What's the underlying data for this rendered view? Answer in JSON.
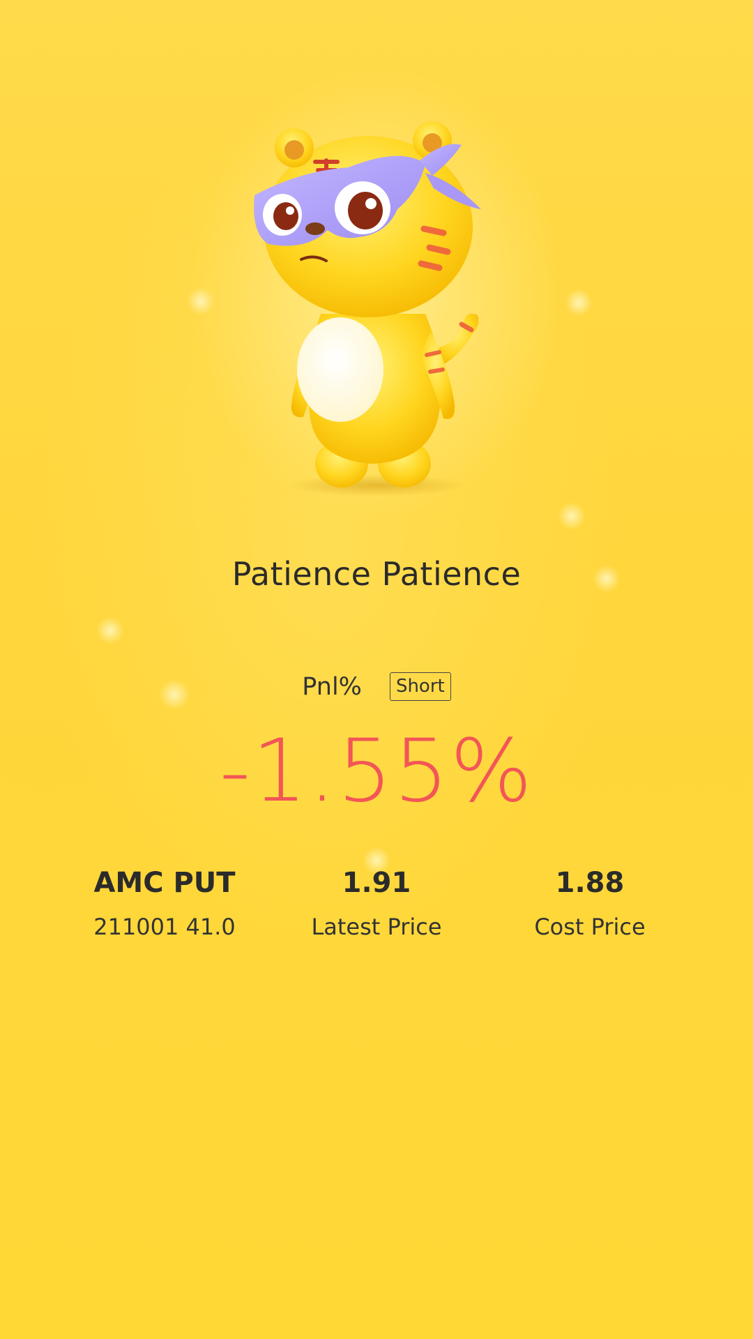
{
  "title": "Patience Patience",
  "pnl": {
    "label": "Pnl%",
    "direction_badge": "Short",
    "value": "-1.55%"
  },
  "position": {
    "symbol": "AMC PUT",
    "contract": "211001 41.0",
    "latest_price": "1.91",
    "latest_price_label": "Latest Price",
    "cost_price": "1.88",
    "cost_price_label": "Cost Price"
  },
  "colors": {
    "background": "#ffd83c",
    "loss_red": "#f25656",
    "text_dark": "#2b2b2b"
  },
  "illustration": "tiger-mascot-masked-icon"
}
